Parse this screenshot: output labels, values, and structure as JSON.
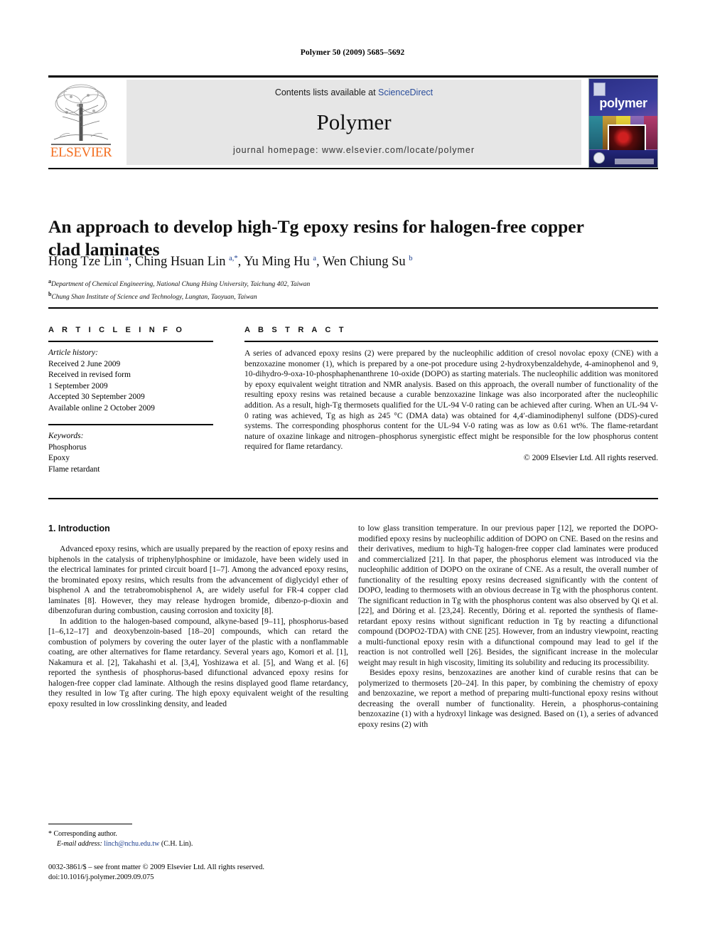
{
  "running_head": "Polymer 50 (2009) 5685–5692",
  "masthead": {
    "publisher_name": "ELSEVIER",
    "contents_prefix": "Contents lists available at ",
    "contents_link": "ScienceDirect",
    "journal_name": "Polymer",
    "homepage": "journal homepage: www.elsevier.com/locate/polymer",
    "cover_title": "polymer"
  },
  "article": {
    "title": "An approach to develop high-Tg epoxy resins for halogen-free copper clad laminates",
    "authors_html": "Hong Tze Lin <sup>a</sup>, Ching Hsuan Lin <sup>a,*</sup>, Yu Ming Hu <sup>a</sup>, Wen Chiung Su <sup>b</sup>",
    "affiliation_a": "Department of Chemical Engineering, National Chung Hsing University, Taichung 402, Taiwan",
    "affiliation_b": "Chung Shan Institute of Science and Technology, Lungtan, Taoyuan, Taiwan"
  },
  "article_info": {
    "heading": "A R T I C L E   I N F O",
    "history_label": "Article history:",
    "history": [
      "Received 2 June 2009",
      "Received in revised form",
      "1 September 2009",
      "Accepted 30 September 2009",
      "Available online 2 October 2009"
    ],
    "keywords_label": "Keywords:",
    "keywords": [
      "Phosphorus",
      "Epoxy",
      "Flame retardant"
    ]
  },
  "abstract": {
    "heading": "A B S T R A C T",
    "text": "A series of advanced epoxy resins (2) were prepared by the nucleophilic addition of cresol novolac epoxy (CNE) with a benzoxazine monomer (1), which is prepared by a one-pot procedure using 2-hydroxybenzaldehyde, 4-aminophenol and 9, 10-dihydro-9-oxa-10-phosphaphenanthrene 10-oxide (DOPO) as starting materials. The nucleophilic addition was monitored by epoxy equivalent weight titration and NMR analysis. Based on this approach, the overall number of functionality of the resulting epoxy resins was retained because a curable benzoxazine linkage was also incorporated after the nucleophilic addition. As a result, high-Tg thermosets qualified for the UL-94 V-0 rating can be achieved after curing. When an UL-94 V-0 rating was achieved, Tg as high as 245 °C (DMA data) was obtained for 4,4′-diaminodiphenyl sulfone (DDS)-cured systems. The corresponding phosphorus content for the UL-94 V-0 rating was as low as 0.61 wt%. The flame-retardant nature of oxazine linkage and nitrogen–phosphorus synergistic effect might be responsible for the low phosphorus content required for flame retardancy.",
    "copyright": "© 2009 Elsevier Ltd. All rights reserved."
  },
  "body": {
    "section_heading": "1.  Introduction",
    "left_paragraphs": [
      "Advanced epoxy resins, which are usually prepared by the reaction of epoxy resins and biphenols in the catalysis of triphenylphosphine or imidazole, have been widely used in the electrical laminates for printed circuit board [1–7]. Among the advanced epoxy resins, the brominated epoxy resins, which results from the advancement of diglycidyl ether of bisphenol A and the tetrabromobisphenol A, are widely useful for FR-4 copper clad laminates [8]. However, they may release hydrogen bromide, dibenzo-p-dioxin and dibenzofuran during combustion, causing corrosion and toxicity [8].",
      "In addition to the halogen-based compound, alkyne-based [9–11], phosphorus-based [1–6,12–17] and deoxybenzoin-based [18–20] compounds, which can retard the combustion of polymers by covering the outer layer of the plastic with a nonflammable coating, are other alternatives for flame retardancy. Several years ago, Komori et al. [1], Nakamura et al. [2], Takahashi et al. [3,4], Yoshizawa et al. [5], and Wang et al. [6] reported the synthesis of phosphorus-based difunctional advanced epoxy resins for halogen-free copper clad laminate. Although the resins displayed good flame retardancy, they resulted in low Tg after curing. The high epoxy equivalent weight of the resulting epoxy resulted in low crosslinking density, and leaded"
    ],
    "right_paragraphs": [
      "to low glass transition temperature. In our previous paper [12], we reported the DOPO-modified epoxy resins by nucleophilic addition of DOPO on CNE. Based on the resins and their derivatives, medium to high-Tg halogen-free copper clad laminates were produced and commercialized [21]. In that paper, the phosphorus element was introduced via the nucleophilic addition of DOPO on the oxirane of CNE. As a result, the overall number of functionality of the resulting epoxy resins decreased significantly with the content of DOPO, leading to thermosets with an obvious decrease in Tg with the phosphorus content. The significant reduction in Tg with the phosphorus content was also observed by Qi et al. [22], and Döring et al. [23,24]. Recently, Döring et al. reported the synthesis of flame-retardant epoxy resins without significant reduction in Tg by reacting a difunctional compound (DOPO2-TDA) with CNE [25]. However, from an industry viewpoint, reacting a multi-functional epoxy resin with a difunctional compound may lead to gel if the reaction is not controlled well [26]. Besides, the significant increase in the molecular weight may result in high viscosity, limiting its solubility and reducing its processibility.",
      "Besides epoxy resins, benzoxazines are another kind of curable resins that can be polymerized to thermosets [20–24]. In this paper, by combining the chemistry of epoxy and benzoxazine, we report a method of preparing multi-functional epoxy resins without decreasing the overall number of functionality. Herein, a phosphorus-containing benzoxazine (1) with a hydroxyl linkage was designed. Based on (1), a series of advanced epoxy resins (2) with"
    ]
  },
  "footer": {
    "corresponding_author": "* Corresponding author.",
    "email_label": "E-mail address:",
    "email": "linch@nchu.edu.tw",
    "email_suffix": " (C.H. Lin).",
    "front_matter": "0032-3861/$ – see front matter © 2009 Elsevier Ltd. All rights reserved.",
    "doi": "doi:10.1016/j.polymer.2009.09.075"
  },
  "colors": {
    "link": "#1d3f8f",
    "elsevier_orange": "#F36F21",
    "panel_grey": "#e6e6e6"
  }
}
